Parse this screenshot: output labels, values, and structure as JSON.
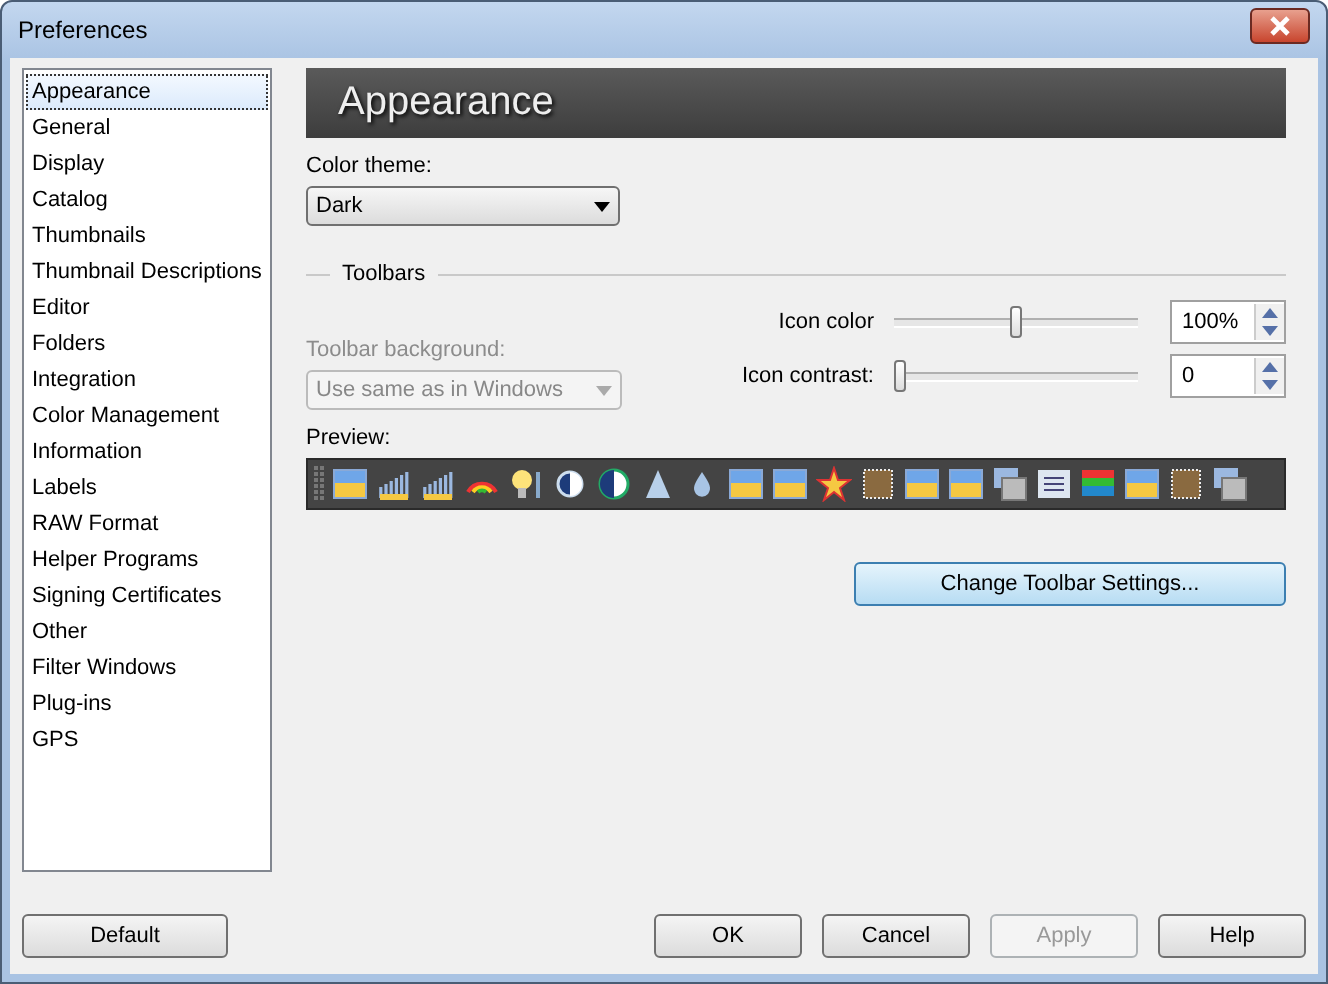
{
  "window": {
    "title": "Preferences"
  },
  "sidebar": {
    "items": [
      {
        "label": "Appearance",
        "selected": true
      },
      {
        "label": "General",
        "selected": false
      },
      {
        "label": "Display",
        "selected": false
      },
      {
        "label": "Catalog",
        "selected": false
      },
      {
        "label": "Thumbnails",
        "selected": false
      },
      {
        "label": "Thumbnail Descriptions",
        "selected": false
      },
      {
        "label": "Editor",
        "selected": false
      },
      {
        "label": "Folders",
        "selected": false
      },
      {
        "label": "Integration",
        "selected": false
      },
      {
        "label": "Color Management",
        "selected": false
      },
      {
        "label": "Information",
        "selected": false
      },
      {
        "label": "Labels",
        "selected": false
      },
      {
        "label": "RAW Format",
        "selected": false
      },
      {
        "label": "Helper Programs",
        "selected": false
      },
      {
        "label": "Signing Certificates",
        "selected": false
      },
      {
        "label": "Other",
        "selected": false
      },
      {
        "label": "Filter Windows",
        "selected": false
      },
      {
        "label": "Plug-ins",
        "selected": false
      },
      {
        "label": "GPS",
        "selected": false
      }
    ]
  },
  "header": "Appearance",
  "color_theme": {
    "label": "Color theme:",
    "value": "Dark"
  },
  "toolbars": {
    "title": "Toolbars",
    "background": {
      "label": "Toolbar background:",
      "value": "Use same as in Windows",
      "disabled": true
    },
    "sliders": [
      {
        "label": "Icon color",
        "level": 0.5,
        "value": "100%"
      },
      {
        "label": "Icon contrast:",
        "level": 0,
        "value": "0"
      }
    ],
    "preview_label": "Preview:",
    "settings_button": "Change Toolbar Settings..."
  },
  "buttons": [
    {
      "label": "Default",
      "disabled": false
    },
    {
      "label": "OK",
      "disabled": false
    },
    {
      "label": "Cancel",
      "disabled": false
    },
    {
      "label": "Apply",
      "disabled": true
    },
    {
      "label": "Help",
      "disabled": false
    }
  ]
}
